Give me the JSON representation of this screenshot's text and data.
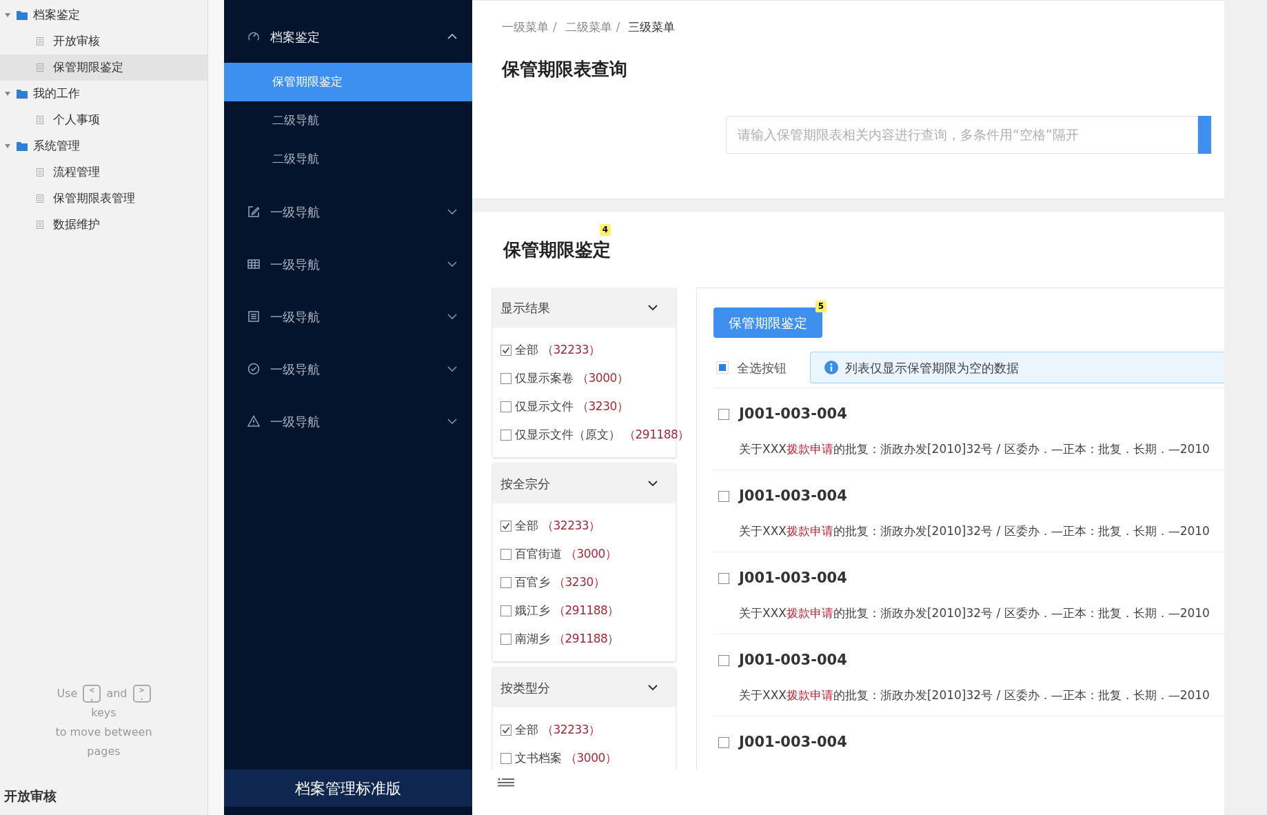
{
  "outline": [
    {
      "label": "档案鉴定",
      "expanded": true,
      "selected": false,
      "children": [
        {
          "label": "开放审核",
          "selected": false
        },
        {
          "label": "保管期限鉴定",
          "selected": true
        }
      ]
    },
    {
      "label": "我的工作",
      "expanded": true,
      "selected": false,
      "children": [
        {
          "label": "个人事项",
          "selected": false
        }
      ]
    },
    {
      "label": "系统管理",
      "expanded": true,
      "selected": false,
      "children": [
        {
          "label": "流程管理",
          "selected": false
        },
        {
          "label": "保管期限表管理",
          "selected": false
        },
        {
          "label": "数据维护",
          "selected": false
        }
      ]
    }
  ],
  "hint": {
    "use": "Use",
    "keys": [
      {
        "top": "<",
        "bottom": ","
      },
      {
        "top": ">",
        "bottom": "."
      }
    ],
    "and": "and",
    "rest": [
      "keys",
      "to move between",
      "pages"
    ]
  },
  "page_heading": "开放审核",
  "nav": {
    "items": [
      {
        "label": "档案鉴定",
        "expanded": true,
        "children": [
          {
            "label": "保管期限鉴定",
            "selected": true
          },
          {
            "label": "二级导航",
            "selected": false
          },
          {
            "label": "二级导航",
            "selected": false
          }
        ]
      },
      {
        "label": "一级导航",
        "expanded": false
      },
      {
        "label": "一级导航",
        "expanded": false
      },
      {
        "label": "一级导航",
        "expanded": false
      },
      {
        "label": "一级导航",
        "expanded": false
      },
      {
        "label": "一级导航",
        "expanded": false
      }
    ],
    "brand": "档案管理标准版"
  },
  "breadcrumb": {
    "items": [
      "一级菜单",
      "二级菜单",
      "三级菜单"
    ],
    "separator": "/"
  },
  "title": "保管期限表查询",
  "search": {
    "placeholder": "请输入保管期限表相关内容进行查询，多条件用“空格”隔开"
  },
  "section": {
    "title": "保管期限鉴定",
    "badge": "4"
  },
  "filters": [
    {
      "title": "显示结果",
      "expanded": true,
      "options": [
        {
          "label": "全部",
          "count": "（32233）",
          "checked": true
        },
        {
          "label": "仅显示案卷",
          "count": "（3000）",
          "checked": false
        },
        {
          "label": "仅显示文件",
          "count": "（3230）",
          "checked": false
        },
        {
          "label": "仅显示文件（原文）",
          "count": "（291188）",
          "checked": false
        }
      ]
    },
    {
      "title": "按全宗分",
      "expanded": true,
      "options": [
        {
          "label": "全部",
          "count": "（32233）",
          "checked": true
        },
        {
          "label": "百官街道",
          "count": "（3000）",
          "checked": false
        },
        {
          "label": "百官乡",
          "count": "（3230）",
          "checked": false
        },
        {
          "label": "娥江乡",
          "count": "（291188）",
          "checked": false
        },
        {
          "label": "南湖乡",
          "count": "（291188）",
          "checked": false
        }
      ]
    },
    {
      "title": "按类型分",
      "expanded": true,
      "options": [
        {
          "label": "全部",
          "count": "（32233）",
          "checked": true
        },
        {
          "label": "文书档案",
          "count": "（3000）",
          "checked": false
        }
      ]
    }
  ],
  "action": {
    "label": "保管期限鉴定",
    "badge": "5"
  },
  "select_all": {
    "label": "全选按钮",
    "indeterminate": true
  },
  "notice": "列表仅显示保管期限为空的数据",
  "records": [
    {
      "code": "J001-003-004",
      "checked": false,
      "desc": {
        "before": "关于XXX",
        "highlight": "拨款申请",
        "after": "的批复：浙政办发[2010]32号 / 区委办．—正本：批复．长期．—2010"
      }
    },
    {
      "code": "J001-003-004",
      "checked": false,
      "desc": {
        "before": "关于XXX",
        "highlight": "拨款申请",
        "after": "的批复：浙政办发[2010]32号 / 区委办．—正本：批复．长期．—2010"
      }
    },
    {
      "code": "J001-003-004",
      "checked": false,
      "desc": {
        "before": "关于XXX",
        "highlight": "拨款申请",
        "after": "的批复：浙政办发[2010]32号 / 区委办．—正本：批复．长期．—2010"
      }
    },
    {
      "code": "J001-003-004",
      "checked": false,
      "desc": {
        "before": "关于XXX",
        "highlight": "拨款申请",
        "after": "的批复：浙政办发[2010]32号 / 区委办．—正本：批复．长期．—2010"
      }
    },
    {
      "code": "J001-003-004",
      "checked": false
    }
  ]
}
